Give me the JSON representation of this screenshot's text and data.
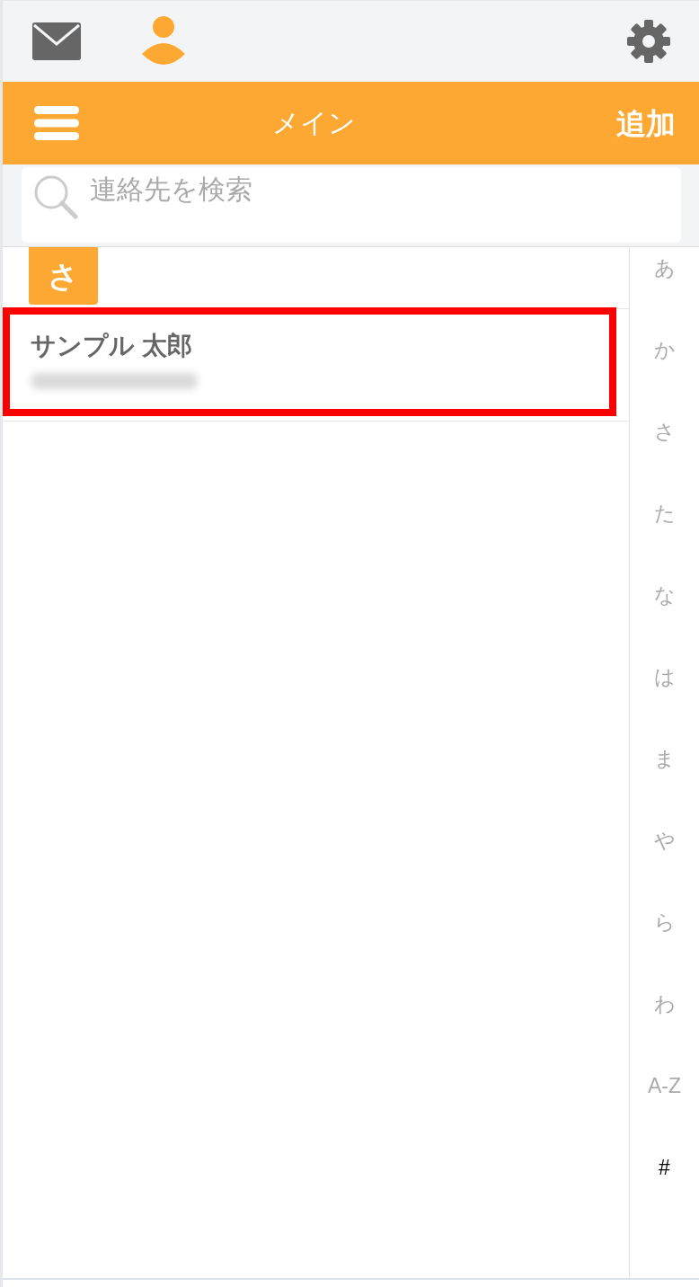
{
  "top_bar": {
    "tabs": [
      {
        "kind": "mail",
        "selected": false
      },
      {
        "kind": "contacts",
        "selected": true
      }
    ]
  },
  "header": {
    "title": "メイン",
    "action": "追加"
  },
  "search": {
    "placeholder": "連絡先を検索"
  },
  "sections": [
    {
      "heading": "さ",
      "contacts": [
        {
          "name": "サンプル 太郎",
          "highlighted": true
        }
      ]
    }
  ],
  "index": [
    {
      "label": "あ",
      "selected": false
    },
    {
      "label": "か",
      "selected": false
    },
    {
      "label": "さ",
      "selected": false
    },
    {
      "label": "た",
      "selected": false
    },
    {
      "label": "な",
      "selected": false
    },
    {
      "label": "は",
      "selected": false
    },
    {
      "label": "ま",
      "selected": false
    },
    {
      "label": "や",
      "selected": false
    },
    {
      "label": "ら",
      "selected": false
    },
    {
      "label": "わ",
      "selected": false
    },
    {
      "label": "A-Z",
      "selected": false
    },
    {
      "label": "#",
      "selected": true
    }
  ]
}
